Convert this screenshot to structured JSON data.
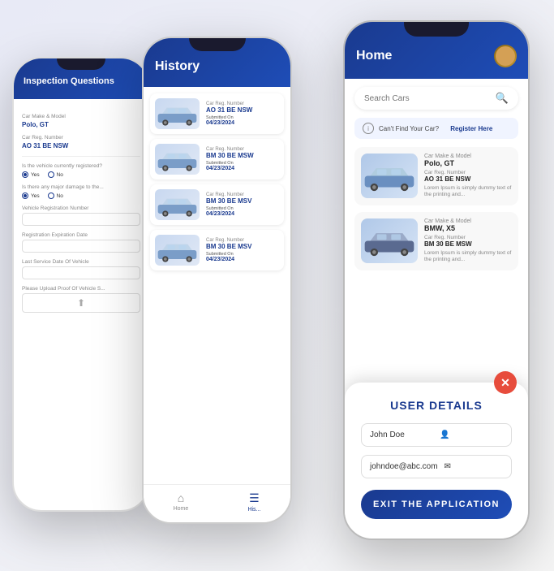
{
  "phone1": {
    "title": "Inspection Questions",
    "carMakeLabel": "Car Make & Model",
    "carMakeValue": "Polo, GT",
    "carRegLabel": "Car Reg. Number",
    "carRegValue": "AO 31 BE NSW",
    "question1": "Is the vehicle currently registered?",
    "question2": "Is there any major damage to the...",
    "vehicleRegLabel": "Vehicle Registration Number",
    "regExpiryLabel": "Registration Expiration Date",
    "lastServiceLabel": "Last Service Date Of Vehicle",
    "uploadLabel": "Please Upload Proof Of Vehicle S..."
  },
  "phone2": {
    "title": "History",
    "items": [
      {
        "regLabel": "Car Reg. Number",
        "regNum": "AO 31 BE NSW",
        "submittedLabel": "Submitted On",
        "date": "04/23/2024"
      },
      {
        "regLabel": "Car Reg. Number",
        "regNum": "BM 30 BE MSW",
        "submittedLabel": "Submitted On",
        "date": "04/23/2024"
      },
      {
        "regLabel": "Car Reg. Number",
        "regNum": "BM 30 BE MSV",
        "submittedLabel": "Submitted On",
        "date": "04/23/2024"
      },
      {
        "regLabel": "Car Reg. Number",
        "regNum": "BM 30 BE MSV",
        "submittedLabel": "Submitted On",
        "date": "04/23/2024"
      }
    ],
    "nav": {
      "home": "Home",
      "history": "His..."
    }
  },
  "phone3": {
    "header": {
      "title": "Home"
    },
    "searchPlaceholder": "Search Cars",
    "cantFind": "Can't Find Your Car?",
    "registerLink": "Register Here",
    "cards": [
      {
        "makeLabel": "Car Make & Model",
        "makeValue": "Polo, GT",
        "regLabel": "Car Reg. Number",
        "regValue": "AO 31 BE NSW",
        "desc": "Lorem Ipsum is simply dummy text of the printing and..."
      },
      {
        "makeLabel": "Car Make & Model",
        "makeValue": "BMW, X5",
        "regLabel": "Car Reg. Number",
        "regValue": "BM 30 BE MSW",
        "desc": "Lorem Ipsum is simply dummy text of the printing and..."
      }
    ],
    "modal": {
      "title": "USER DETAILS",
      "nameValue": "John Doe",
      "emailValue": "johndoe@abc.com",
      "exitLabel": "EXIT THE APPLICATION"
    }
  }
}
